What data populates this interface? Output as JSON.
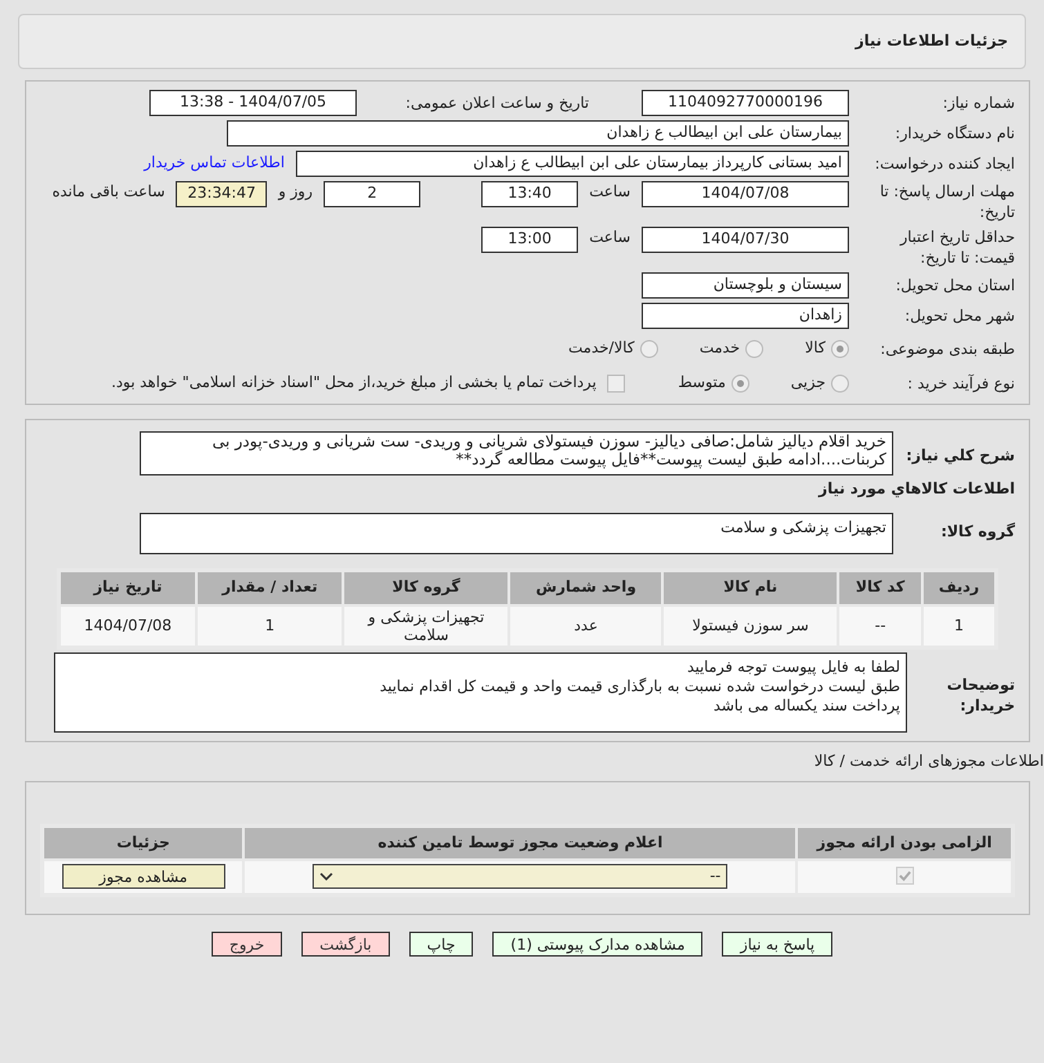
{
  "header": {
    "title": "جزئیات اطلاعات نیاز"
  },
  "form": {
    "need_number": {
      "label": "شماره نیاز:",
      "value": "1104092770000196"
    },
    "announce": {
      "label": "تاریخ و ساعت اعلان عمومی:",
      "value": "1404/07/05 - 13:38"
    },
    "buyer_org": {
      "label": "نام دستگاه خریدار:",
      "value": "بیمارستان علی ابن ابیطالب  ع  زاهدان"
    },
    "requester": {
      "label": "ایجاد کننده درخواست:",
      "value": "امید بستانی کارپرداز  بیمارستان علی ابن ابیطالب  ع  زاهدان",
      "link": "اطلاعات تماس خریدار"
    },
    "deadline": {
      "label": "مهلت ارسال پاسخ: تا تاریخ:",
      "date": "1404/07/08",
      "time_label": "ساعت",
      "time": "13:40",
      "days": "2",
      "days_label": "روز و",
      "remaining": "23:34:47",
      "remaining_label": "ساعت باقی مانده"
    },
    "validity": {
      "label": "حداقل تاریخ اعتبار قیمت: تا تاریخ:",
      "date": "1404/07/30",
      "time_label": "ساعت",
      "time": "13:00"
    },
    "province": {
      "label": "استان محل تحویل:",
      "value": "سیستان و بلوچستان"
    },
    "city": {
      "label": "شهر محل تحویل:",
      "value": "زاهدان"
    },
    "category": {
      "label": "طبقه بندی موضوعی:",
      "options": [
        {
          "label": "کالا",
          "selected": true
        },
        {
          "label": "خدمت",
          "selected": false
        },
        {
          "label": "کالا/خدمت",
          "selected": false
        }
      ]
    },
    "purchase_type": {
      "label": "نوع فرآیند خرید :",
      "options": [
        {
          "label": "جزیی",
          "selected": false
        },
        {
          "label": "متوسط",
          "selected": true
        }
      ],
      "treasury": {
        "label": "پرداخت تمام یا بخشی از مبلغ خرید،از محل \"اسناد خزانه اسلامی\" خواهد بود.",
        "checked": false
      }
    }
  },
  "description": {
    "label": "شرح کلي نياز:",
    "value": "خرید اقلام دیالیز شامل:صافی دیالیز- سوزن فیستولای شریانی و وریدی- ست شریانی و وریدی-پودر بی کربنات....ادامه  طبق لیست پیوست**فایل پیوست مطالعه گردد**"
  },
  "goods": {
    "title": "اطلاعات کالاهاي مورد نياز",
    "group_label": "گروه کالا:",
    "group_value": "تجهیزات پزشکی و سلامت",
    "columns": [
      "ردیف",
      "کد کالا",
      "نام کالا",
      "واحد شمارش",
      "گروه کالا",
      "تعداد / مقدار",
      "تاریخ نیاز"
    ],
    "rows": [
      [
        "1",
        "--",
        "سر سوزن فیستولا",
        "عدد",
        "تجهیزات پزشکی و سلامت",
        "1",
        "1404/07/08"
      ]
    ]
  },
  "buyer_notes": {
    "label": "توضیحات خریدار:",
    "lines": [
      "لطفا به فایل پیوست توجه فرمایید",
      "طبق لیست درخواست شده نسبت به بارگذاری قیمت واحد و قیمت کل اقدام نمایید",
      "پرداخت سند یکساله می باشد"
    ]
  },
  "licenses": {
    "title": "اطلاعات مجوزهای ارائه خدمت / کالا",
    "columns": [
      "الزامی بودن ارائه مجوز",
      "اعلام وضعیت مجوز توسط تامین کننده",
      "جزئیات"
    ],
    "rows": [
      {
        "required": true,
        "status": "--",
        "button": "مشاهده مجوز"
      }
    ]
  },
  "buttons": [
    {
      "label": "پاسخ به نیاز",
      "kind": "action"
    },
    {
      "label": "مشاهده مدارک پیوستی (1)",
      "kind": "action"
    },
    {
      "label": "چاپ",
      "kind": "action"
    },
    {
      "label": "بازگشت",
      "kind": "exit"
    },
    {
      "label": "خروج",
      "kind": "exit"
    }
  ]
}
